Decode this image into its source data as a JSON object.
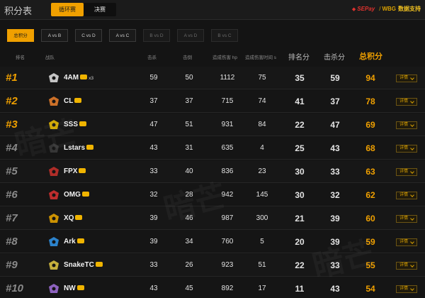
{
  "header": {
    "title": "积分表",
    "stage_tabs": [
      "循环赛",
      "决赛"
    ],
    "sponsor_logo": "SEPay",
    "sponsor_brand": "WBG",
    "sponsor_text": "数据支持"
  },
  "match_tabs": [
    {
      "label": "总积分",
      "state": "active"
    },
    {
      "label": "A vs B",
      "state": "normal"
    },
    {
      "label": "C vs D",
      "state": "normal"
    },
    {
      "label": "A vs C",
      "state": "normal"
    },
    {
      "label": "B vs D",
      "state": "dim"
    },
    {
      "label": "A vs D",
      "state": "dim"
    },
    {
      "label": "B vs C",
      "state": "dim"
    }
  ],
  "columns": {
    "rank": "排名",
    "team": "战队",
    "kills": "击杀",
    "eliminated": "击倒",
    "damage": "造成伤害 hp",
    "survival": "造成伤害时间 s",
    "rank_points": "排名分",
    "kill_points": "击杀分",
    "total": "总积分"
  },
  "detail_label": "详情",
  "watermark": "暗芒",
  "rows": [
    {
      "rank": "#1",
      "team": "4AM",
      "mult": "x3",
      "kills": "59",
      "eliminated": "50",
      "damage": "1112",
      "survival": "75",
      "rank_points": "35",
      "kill_points": "59",
      "total": "94",
      "logo_color": "#d8d8d8"
    },
    {
      "rank": "#2",
      "team": "CL",
      "mult": "",
      "kills": "37",
      "eliminated": "37",
      "damage": "715",
      "survival": "74",
      "rank_points": "41",
      "kill_points": "37",
      "total": "78",
      "logo_color": "#e07a2a"
    },
    {
      "rank": "#3",
      "team": "SSS",
      "mult": "",
      "kills": "47",
      "eliminated": "51",
      "damage": "931",
      "survival": "84",
      "rank_points": "22",
      "kill_points": "47",
      "total": "69",
      "logo_color": "#e6b800"
    },
    {
      "rank": "#4",
      "team": "Lstars",
      "mult": "",
      "kills": "43",
      "eliminated": "31",
      "damage": "635",
      "survival": "4",
      "rank_points": "25",
      "kill_points": "43",
      "total": "68",
      "logo_color": "#3a3a3a"
    },
    {
      "rank": "#5",
      "team": "FPX",
      "mult": "",
      "kills": "33",
      "eliminated": "40",
      "damage": "836",
      "survival": "23",
      "rank_points": "30",
      "kill_points": "33",
      "total": "63",
      "logo_color": "#c0302a"
    },
    {
      "rank": "#6",
      "team": "OMG",
      "mult": "",
      "kills": "32",
      "eliminated": "28",
      "damage": "942",
      "survival": "145",
      "rank_points": "30",
      "kill_points": "32",
      "total": "62",
      "logo_color": "#d03030"
    },
    {
      "rank": "#7",
      "team": "XQ",
      "mult": "",
      "kills": "39",
      "eliminated": "46",
      "damage": "987",
      "survival": "300",
      "rank_points": "21",
      "kill_points": "39",
      "total": "60",
      "logo_color": "#e0a000"
    },
    {
      "rank": "#8",
      "team": "Ark",
      "mult": "",
      "kills": "39",
      "eliminated": "34",
      "damage": "760",
      "survival": "5",
      "rank_points": "20",
      "kill_points": "39",
      "total": "59",
      "logo_color": "#2f8fe0"
    },
    {
      "rank": "#9",
      "team": "SnakeTC",
      "mult": "",
      "kills": "33",
      "eliminated": "26",
      "damage": "923",
      "survival": "51",
      "rank_points": "22",
      "kill_points": "33",
      "total": "55",
      "logo_color": "#d8c040"
    },
    {
      "rank": "#10",
      "team": "NW",
      "mult": "",
      "kills": "43",
      "eliminated": "45",
      "damage": "892",
      "survival": "17",
      "rank_points": "11",
      "kill_points": "43",
      "total": "54",
      "logo_color": "#9a6ad0"
    }
  ]
}
